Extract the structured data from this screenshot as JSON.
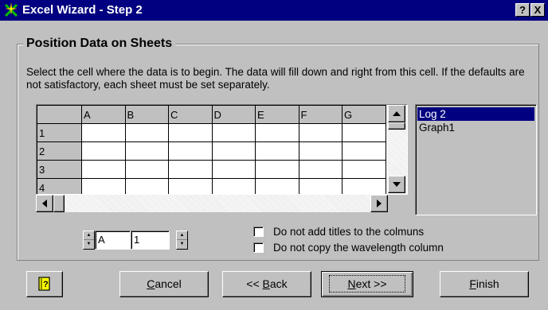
{
  "window": {
    "title": "Excel Wizard - Step 2",
    "app_icon": "excel-wizard-icon",
    "help_button": "?",
    "close_button": "X"
  },
  "group": {
    "title": "Position Data on Sheets",
    "instructions": "Select the cell where the data is to begin. The data will fill down and right from this cell. If the defaults are not satisfactory, each sheet must be set separately."
  },
  "grid": {
    "columns": [
      "A",
      "B",
      "C",
      "D",
      "E",
      "F",
      "G"
    ],
    "rows": [
      "1",
      "2",
      "3",
      "4"
    ]
  },
  "sheets": {
    "items": [
      "Log 2",
      "Graph1"
    ],
    "selected": "Log 2"
  },
  "cell_position": {
    "column": "A",
    "row": "1"
  },
  "options": {
    "no_titles_label": "Do not add titles to the colmuns",
    "no_titles_checked": false,
    "no_wavelength_label": "Do not copy the wavelength column",
    "no_wavelength_checked": false
  },
  "buttons": {
    "help_icon": "help-book-icon",
    "cancel_mnemonic": "C",
    "cancel_rest": "ancel",
    "back_prefix": "<< ",
    "back_mnemonic": "B",
    "back_rest": "ack",
    "next_mnemonic": "N",
    "next_rest": "ext >>",
    "finish_mnemonic": "F",
    "finish_rest": "inish"
  },
  "colors": {
    "title_bar": "#000080",
    "face": "#c0c0c0",
    "selection": "#000080"
  }
}
